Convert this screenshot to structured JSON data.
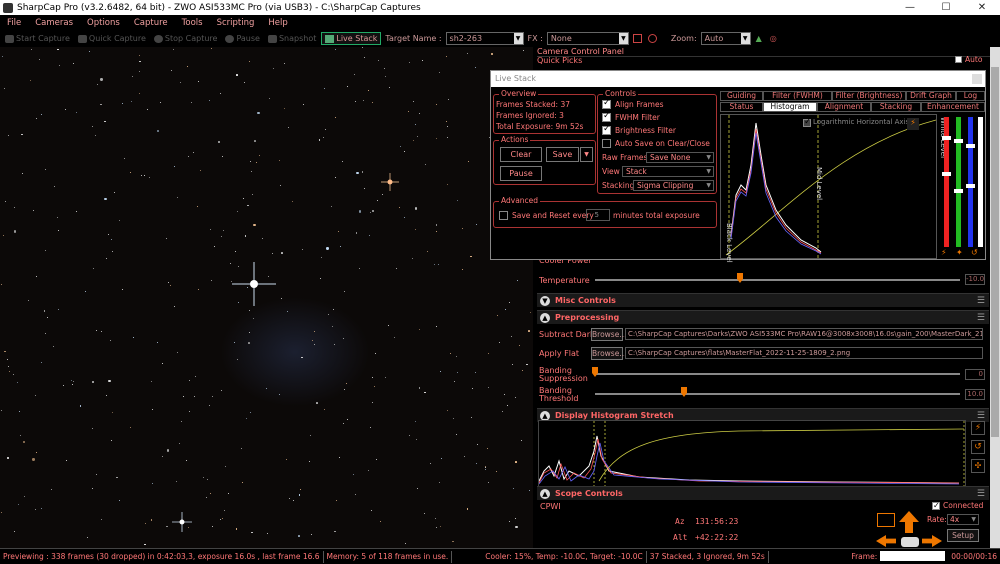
{
  "window": {
    "title": "SharpCap Pro (v3.2.6482, 64 bit) - ZWO ASI533MC Pro (via USB3) - C:\\SharpCap Captures",
    "minimize": "—",
    "maximize": "☐",
    "close": "✕"
  },
  "menu": [
    "File",
    "Cameras",
    "Options",
    "Capture",
    "Tools",
    "Scripting",
    "Help"
  ],
  "toolbar": {
    "start_capture": "Start Capture",
    "quick_capture": "Quick Capture",
    "stop_capture": "Stop Capture",
    "pause": "Pause",
    "snapshot": "Snapshot",
    "live_stack": "Live Stack",
    "target_label": "Target Name :",
    "target_value": "sh2-263",
    "fx_label": "FX :",
    "fx_value": "None",
    "zoom_label": "Zoom:",
    "zoom_value": "Auto"
  },
  "panel": {
    "title": "Camera Control Panel",
    "quick_picks": "Quick Picks",
    "auto_label": "Auto",
    "cooler_power": "Cooler Power",
    "temperature_label": "Temperature",
    "temperature_value": "-10.0",
    "misc_controls": "Misc Controls",
    "preprocessing": "Preprocessing",
    "subtract_dark_label": "Subtract Dark",
    "browse": "Browse...",
    "dark_path": "C:\\SharpCap Captures\\Darks\\ZWO ASI533MC Pro\\RAW16@3008x3008\\16.0s\\gain_200\\MasterDark_21_...",
    "apply_flat_label": "Apply Flat",
    "flat_path": "C:\\SharpCap Captures\\flats\\MasterFlat_2022-11-25-1809_2.png",
    "banding_suppression_label": "Banding Suppression",
    "banding_suppression_value": "0",
    "banding_threshold_label": "Banding Threshold",
    "banding_threshold_value": "10.0",
    "display_histogram_stretch": "Display Histogram Stretch",
    "scope_controls": "Scope Controls",
    "connected_label": "Connected",
    "cpwi": "CPWI",
    "az_label": "Az",
    "az_value": "131:56:23",
    "alt_label": "Alt",
    "alt_value": "+42:22:22",
    "rate_label": "Rate:",
    "rate_value": "4x",
    "setup": "Setup"
  },
  "livestack": {
    "title": "Live Stack",
    "overview_title": "Overview",
    "frames_stacked": "Frames Stacked: 37",
    "frames_ignored": "Frames Ignored:  3",
    "total_exposure": "Total Exposure:  9m 52s",
    "actions_title": "Actions",
    "clear": "Clear",
    "save": "Save",
    "pause": "Pause",
    "advanced_title": "Advanced",
    "save_reset_label": "Save and Reset every",
    "save_reset_value": "5",
    "save_reset_suffix": "minutes total exposure",
    "controls_title": "Controls",
    "align_frames": "Align Frames",
    "fwhm_filter": "FWHM Filter",
    "brightness_filter": "Brightness Filter",
    "auto_save": "Auto Save on Clear/Close",
    "raw_frames_label": "Raw Frames",
    "raw_frames_value": "Save None",
    "view_label": "View",
    "view_value": "Stack",
    "stacking_label": "Stacking",
    "stacking_value": "Sigma Clipping",
    "tabs_row1": [
      "Guiding",
      "Filter (FWHM)",
      "Filter (Brightness)",
      "Drift Graph",
      "Log"
    ],
    "tabs_row2": [
      "Status",
      "Histogram",
      "Alignment",
      "Stacking",
      "Enhancement"
    ],
    "active_tab": "Histogram",
    "log_axis_label": "Logarithmic Horizontal Axis",
    "black_level": "Black Level",
    "mid_level": "Mid Level",
    "white_level": "White Level"
  },
  "status": {
    "previewing": "Previewing : 338 frames (30 dropped) in 0:42:03,3, exposure 16.0s , last frame 16.6",
    "memory": "Memory: 5 of 118 frames in use.",
    "cooler": "Cooler: 15%, Temp: -10.0C, Target: -10.0C",
    "stacked": "37 Stacked, 3 Ignored, 9m 52s",
    "frame_label": "Frame:",
    "time": "00:00/00:16"
  },
  "colors": {
    "accent_red": "#ff7777",
    "live_stack_border": "#22aa66",
    "slider_orange": "#ee7700"
  }
}
